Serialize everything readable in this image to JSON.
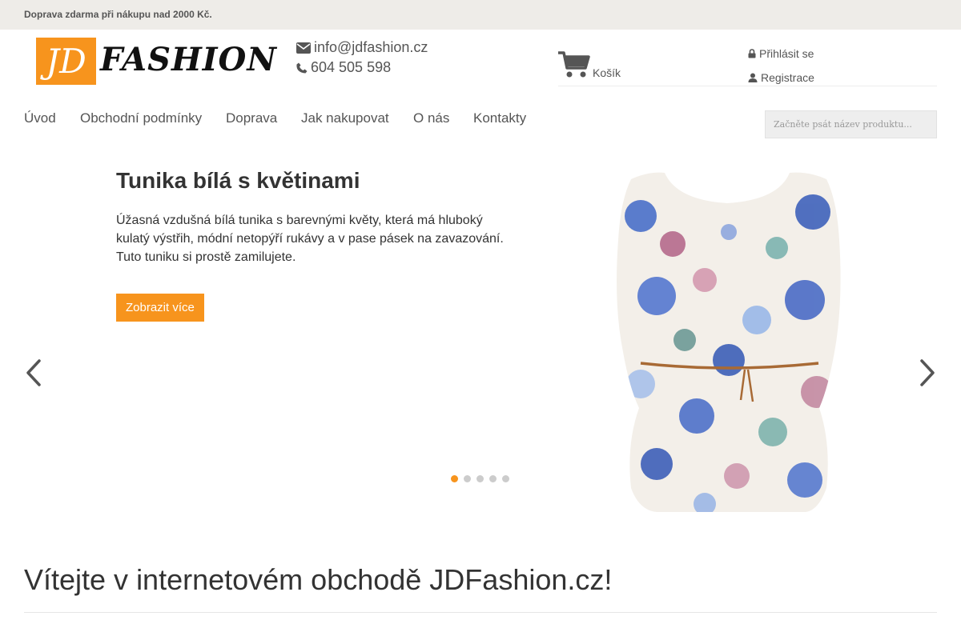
{
  "topbar": {
    "text": "Doprava zdarma při nákupu nad 2000 Kč."
  },
  "logo": {
    "box_text": "JD",
    "word": "FASHION",
    "accent": "#f7941d"
  },
  "contact": {
    "email": "info@jdfashion.cz",
    "phone": "604 505 598",
    "email_icon": "envelope-icon",
    "phone_icon": "phone-icon"
  },
  "cart": {
    "label": "Košík",
    "icon": "cart-icon"
  },
  "account": {
    "login": "Přihlásit se",
    "register": "Registrace",
    "login_icon": "lock-icon",
    "register_icon": "user-icon"
  },
  "nav": {
    "items": [
      "Úvod",
      "Obchodní podmínky",
      "Doprava",
      "Jak nakupovat",
      "O nás",
      "Kontakty"
    ]
  },
  "search": {
    "placeholder": "Začněte psát název produktu..."
  },
  "slider": {
    "title": "Tunika bílá s květinami",
    "description": "Úžasná vzdušná bílá tunika s barevnými květy, která má hluboký kulatý výstřih, módní netopýří rukávy a v pase pásek na zavazování. Tuto tuniku si prostě zamilujete.",
    "button": "Zobrazit více",
    "slide_count": 5,
    "active_slide": 1,
    "prev_icon": "chevron-left-icon",
    "next_icon": "chevron-right-icon"
  },
  "welcome": {
    "heading": "Vítejte v internetovém obchodě JDFashion.cz!"
  }
}
